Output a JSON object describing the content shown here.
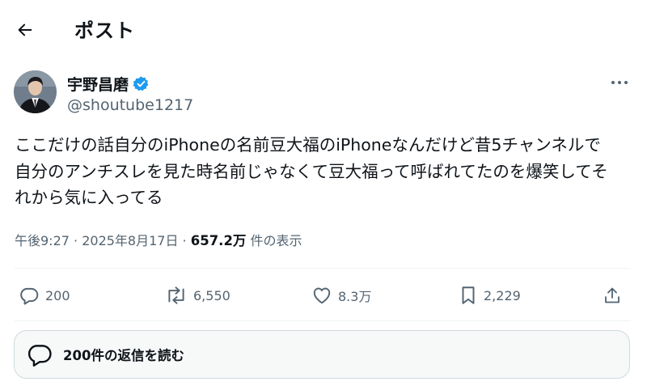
{
  "header": {
    "title": "ポスト",
    "back_icon": "arrow-left-icon"
  },
  "author": {
    "name": "宇野昌磨",
    "handle": "@shoutube1217",
    "verified": true,
    "verified_color": "#1d9bf0"
  },
  "tweet": {
    "text": "ここだけの話自分のiPhoneの名前豆大福のiPhoneなんだけど昔5チャンネルで\n自分のアンチスレを見た時名前じゃなくて豆大福って呼ばれてたのを爆笑してそ\nれから気に入ってる"
  },
  "meta": {
    "time": "午後9:27",
    "separator": " · ",
    "date": "2025年8月17日",
    "views_count": "657.2万",
    "views_label": "件の表示"
  },
  "actions": {
    "replies": "200",
    "reposts": "6,550",
    "likes": "8.3万",
    "bookmarks": "2,229"
  },
  "replies_bar": {
    "label": "200件の返信を読む"
  },
  "colors": {
    "text": "#0f1419",
    "secondary": "#536471",
    "accent": "#1d9bf0"
  }
}
